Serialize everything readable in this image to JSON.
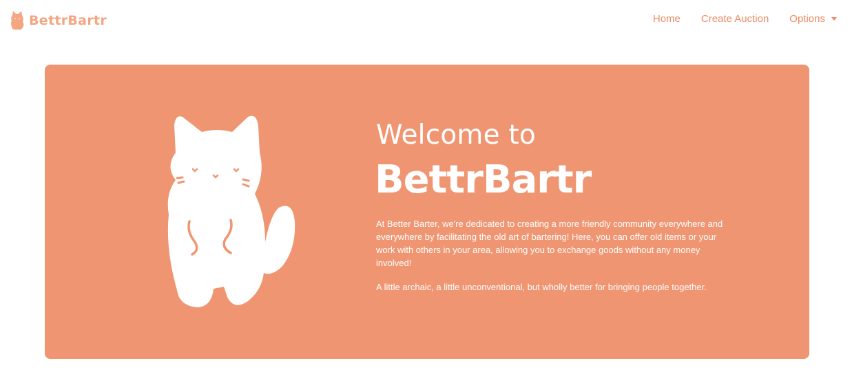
{
  "navbar": {
    "brand": "BettrBartr",
    "links": [
      {
        "label": "Home"
      },
      {
        "label": "Create Auction"
      },
      {
        "label": "Options"
      }
    ]
  },
  "hero": {
    "heading": "Welcome to",
    "brand": "BettrBartr",
    "paragraph1": "At Better Barter, we're dedicated to creating a more friendly community everywhere and everywhere by facilitating the old art of bartering! Here, you can offer old items or your work with others in your area, allowing you to exchange goods without any money involved!",
    "paragraph2": "A little archaic, a little unconventional, but wholly better for bringing people together."
  },
  "colors": {
    "accent": "#f09571",
    "nav_link": "#ec8b62",
    "brand_small": "#f4a582",
    "text_on_accent": "#ffffff"
  }
}
